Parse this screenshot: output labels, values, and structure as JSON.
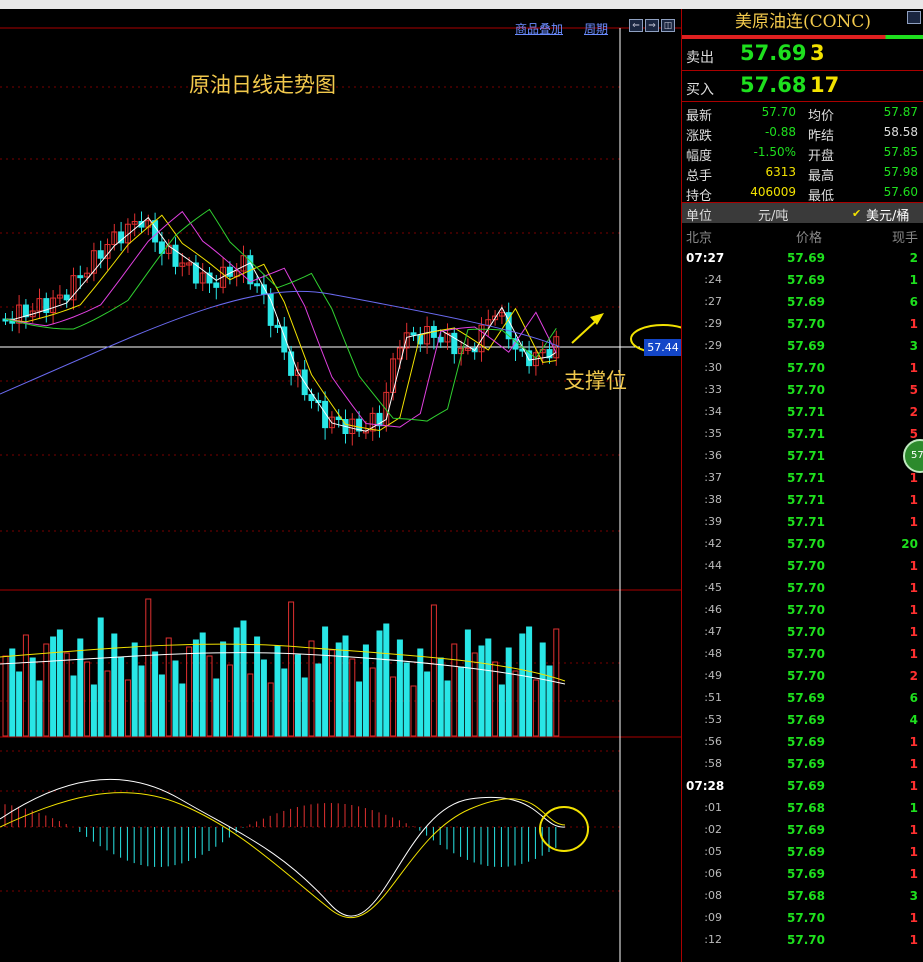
{
  "toolbar": {
    "overlay_label": "商品叠加",
    "period_label": "周期"
  },
  "chart": {
    "title": "原油日线走势图",
    "support_label": "支撑位",
    "current_price_tag": "57.44"
  },
  "panel": {
    "title": "美原油连(CONC)",
    "sell": {
      "label": "卖出",
      "price": "57.69",
      "qty": "3"
    },
    "buy": {
      "label": "买入",
      "price": "57.68",
      "qty": "17"
    },
    "stats": [
      {
        "l1": "最新",
        "v1": "57.70",
        "c1": "#1ee01e",
        "l2": "均价",
        "v2": "57.87",
        "c2": "#1ee01e"
      },
      {
        "l1": "涨跌",
        "v1": "-0.88",
        "c1": "#1ee01e",
        "l2": "昨结",
        "v2": "58.58",
        "c2": "#dddddd"
      },
      {
        "l1": "幅度",
        "v1": "-1.50%",
        "c1": "#1ee01e",
        "l2": "开盘",
        "v2": "57.85",
        "c2": "#1ee01e"
      },
      {
        "l1": "总手",
        "v1": "6313",
        "c1": "#f2e200",
        "l2": "最高",
        "v2": "57.98",
        "c2": "#1ee01e"
      },
      {
        "l1": "持仓",
        "v1": "406009",
        "c1": "#f2e200",
        "l2": "最低",
        "v2": "57.60",
        "c2": "#1ee01e"
      }
    ],
    "unit": {
      "label": "单位",
      "option1": "元/吨",
      "check": "✔",
      "option2": "美元/桶"
    },
    "ticks_header": {
      "time": "北京",
      "price": "价格",
      "vol": "现手"
    },
    "ticks": [
      {
        "time": "07:27",
        "full": true,
        "price": "57.69",
        "vol": "2",
        "color": "#1ee01e"
      },
      {
        "time": ":24",
        "price": "57.69",
        "vol": "1",
        "color": "#1ee01e"
      },
      {
        "time": ":27",
        "price": "57.69",
        "vol": "6",
        "color": "#1ee01e"
      },
      {
        "time": ":29",
        "price": "57.70",
        "vol": "1",
        "color": "#ff3030"
      },
      {
        "time": ":29",
        "price": "57.69",
        "vol": "3",
        "color": "#1ee01e"
      },
      {
        "time": ":30",
        "price": "57.70",
        "vol": "1",
        "color": "#ff3030"
      },
      {
        "time": ":33",
        "price": "57.70",
        "vol": "5",
        "color": "#ff3030"
      },
      {
        "time": ":34",
        "price": "57.71",
        "vol": "2",
        "color": "#ff3030"
      },
      {
        "time": ":35",
        "price": "57.71",
        "vol": "5",
        "color": "#ff3030"
      },
      {
        "time": ":36",
        "price": "57.71",
        "vol": "1",
        "color": "#ff3030"
      },
      {
        "time": ":37",
        "price": "57.71",
        "vol": "1",
        "color": "#ff3030"
      },
      {
        "time": ":38",
        "price": "57.71",
        "vol": "1",
        "color": "#ff3030"
      },
      {
        "time": ":39",
        "price": "57.71",
        "vol": "1",
        "color": "#ff3030"
      },
      {
        "time": ":42",
        "price": "57.70",
        "vol": "20",
        "color": "#1ee01e"
      },
      {
        "time": ":44",
        "price": "57.70",
        "vol": "1",
        "color": "#ff3030"
      },
      {
        "time": ":45",
        "price": "57.70",
        "vol": "1",
        "color": "#ff3030"
      },
      {
        "time": ":46",
        "price": "57.70",
        "vol": "1",
        "color": "#ff3030"
      },
      {
        "time": ":47",
        "price": "57.70",
        "vol": "1",
        "color": "#ff3030"
      },
      {
        "time": ":48",
        "price": "57.70",
        "vol": "1",
        "color": "#ff3030"
      },
      {
        "time": ":49",
        "price": "57.70",
        "vol": "2",
        "color": "#ff3030"
      },
      {
        "time": ":51",
        "price": "57.69",
        "vol": "6",
        "color": "#1ee01e"
      },
      {
        "time": ":53",
        "price": "57.69",
        "vol": "4",
        "color": "#1ee01e"
      },
      {
        "time": ":56",
        "price": "57.69",
        "vol": "1",
        "color": "#ff3030"
      },
      {
        "time": ":58",
        "price": "57.69",
        "vol": "1",
        "color": "#ff3030"
      },
      {
        "time": "07:28",
        "full": true,
        "price": "57.69",
        "vol": "1",
        "color": "#ff3030"
      },
      {
        "time": ":01",
        "price": "57.68",
        "vol": "1",
        "color": "#1ee01e"
      },
      {
        "time": ":02",
        "price": "57.69",
        "vol": "1",
        "color": "#ff3030"
      },
      {
        "time": ":05",
        "price": "57.69",
        "vol": "1",
        "color": "#ff3030"
      },
      {
        "time": ":06",
        "price": "57.69",
        "vol": "1",
        "color": "#ff3030"
      },
      {
        "time": ":08",
        "price": "57.68",
        "vol": "3",
        "color": "#1ee01e"
      },
      {
        "time": ":09",
        "price": "57.70",
        "vol": "1",
        "color": "#ff3030"
      },
      {
        "time": ":12",
        "price": "57.70",
        "vol": "1",
        "color": "#ff3030"
      }
    ],
    "bubble_text": "57"
  },
  "colors": {
    "up": "#ff3030",
    "down": "#1ee01e",
    "candle_up": "#e03030",
    "candle_down": "#29e6e6",
    "accent": "#f2c94c",
    "grid": "#7a0000"
  }
}
